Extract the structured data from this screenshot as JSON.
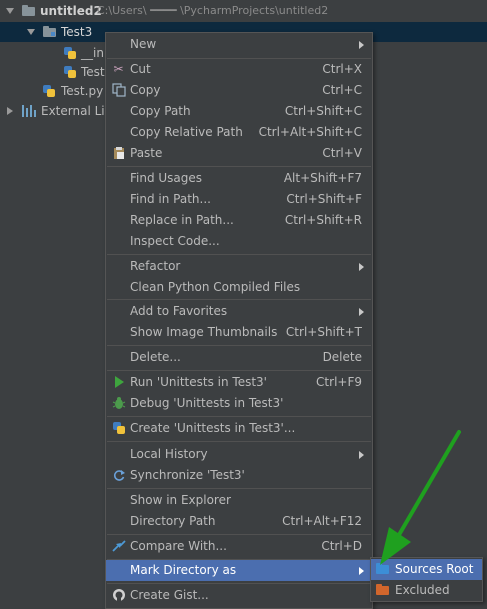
{
  "tree": {
    "root_name": "untitled2",
    "root_path": "C:\\Users\\ ━━━━ \\PycharmProjects\\untitled2",
    "items": [
      {
        "label": "Test3"
      },
      {
        "label": "__ini"
      },
      {
        "label": "Test("
      },
      {
        "label": "Test.py"
      },
      {
        "label": "External Libr"
      }
    ]
  },
  "menu": {
    "items": [
      {
        "label": "New",
        "shortcut": "",
        "submenu": true,
        "icon": ""
      },
      {
        "label": "Cut",
        "shortcut": "Ctrl+X",
        "submenu": false,
        "icon": "scissors-icon"
      },
      {
        "label": "Copy",
        "shortcut": "Ctrl+C",
        "submenu": false,
        "icon": "copy-icon"
      },
      {
        "label": "Copy Path",
        "shortcut": "Ctrl+Shift+C",
        "submenu": false,
        "icon": ""
      },
      {
        "label": "Copy Relative Path",
        "shortcut": "Ctrl+Alt+Shift+C",
        "submenu": false,
        "icon": ""
      },
      {
        "label": "Paste",
        "shortcut": "Ctrl+V",
        "submenu": false,
        "icon": "paste-icon"
      },
      {
        "label": "Find Usages",
        "shortcut": "Alt+Shift+F7",
        "submenu": false,
        "icon": ""
      },
      {
        "label": "Find in Path...",
        "shortcut": "Ctrl+Shift+F",
        "submenu": false,
        "icon": ""
      },
      {
        "label": "Replace in Path...",
        "shortcut": "Ctrl+Shift+R",
        "submenu": false,
        "icon": ""
      },
      {
        "label": "Inspect Code...",
        "shortcut": "",
        "submenu": false,
        "icon": ""
      },
      {
        "label": "Refactor",
        "shortcut": "",
        "submenu": true,
        "icon": ""
      },
      {
        "label": "Clean Python Compiled Files",
        "shortcut": "",
        "submenu": false,
        "icon": ""
      },
      {
        "label": "Add to Favorites",
        "shortcut": "",
        "submenu": true,
        "icon": ""
      },
      {
        "label": "Show Image Thumbnails",
        "shortcut": "Ctrl+Shift+T",
        "submenu": false,
        "icon": ""
      },
      {
        "label": "Delete...",
        "shortcut": "Delete",
        "submenu": false,
        "icon": ""
      },
      {
        "label": "Run 'Unittests in Test3'",
        "shortcut": "Ctrl+F9",
        "submenu": false,
        "icon": "run-icon"
      },
      {
        "label": "Debug 'Unittests in Test3'",
        "shortcut": "",
        "submenu": false,
        "icon": "debug-icon"
      },
      {
        "label": "Create 'Unittests in Test3'...",
        "shortcut": "",
        "submenu": false,
        "icon": "python-icon"
      },
      {
        "label": "Local History",
        "shortcut": "",
        "submenu": true,
        "icon": ""
      },
      {
        "label": "Synchronize 'Test3'",
        "shortcut": "",
        "submenu": false,
        "icon": "sync-icon"
      },
      {
        "label": "Show in Explorer",
        "shortcut": "",
        "submenu": false,
        "icon": ""
      },
      {
        "label": "Directory Path",
        "shortcut": "Ctrl+Alt+F12",
        "submenu": false,
        "icon": ""
      },
      {
        "label": "Compare With...",
        "shortcut": "Ctrl+D",
        "submenu": false,
        "icon": "compare-icon"
      },
      {
        "label": "Mark Directory as",
        "shortcut": "",
        "submenu": true,
        "icon": ""
      },
      {
        "label": "Create Gist...",
        "shortcut": "",
        "submenu": false,
        "icon": "github-icon"
      }
    ]
  },
  "submenu": {
    "items": [
      {
        "label": "Sources Root",
        "icon": "sources-root-folder-icon"
      },
      {
        "label": "Excluded",
        "icon": "excluded-folder-icon"
      }
    ]
  },
  "colors": {
    "background": "#3c3f41",
    "selection": "#0d293e",
    "menu_highlight": "#4b6eaf",
    "sources_root": "#3c8ed6",
    "excluded": "#d1662c",
    "annotation_arrow": "#1fa01f"
  }
}
